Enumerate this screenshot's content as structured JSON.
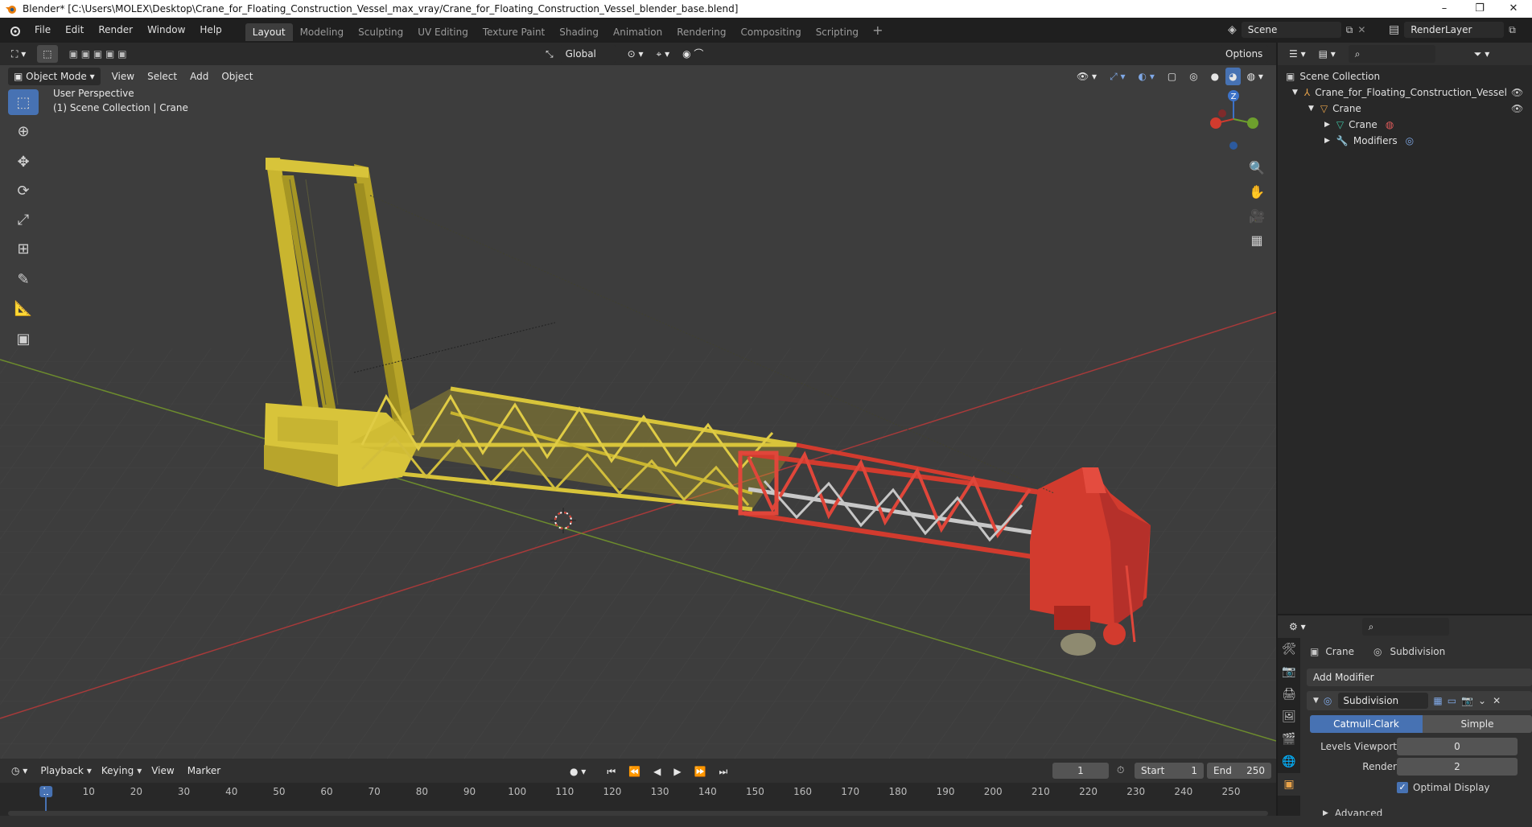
{
  "window": {
    "title": "Blender* [C:\\Users\\MOLEX\\Desktop\\Crane_for_Floating_Construction_Vessel_max_vray/Crane_for_Floating_Construction_Vessel_blender_base.blend]",
    "minimize": "–",
    "restore": "❐",
    "close": "✕"
  },
  "menu": {
    "file": "File",
    "edit": "Edit",
    "render": "Render",
    "window": "Window",
    "help": "Help"
  },
  "workspaces": [
    "Layout",
    "Modeling",
    "Sculpting",
    "UV Editing",
    "Texture Paint",
    "Shading",
    "Animation",
    "Rendering",
    "Compositing",
    "Scripting"
  ],
  "active_workspace": "Layout",
  "scene": {
    "name": "Scene",
    "view_layer": "RenderLayer"
  },
  "viewport": {
    "mode": "Object Mode",
    "menus": [
      "View",
      "Select",
      "Add",
      "Object"
    ],
    "transform_orientation": "Global",
    "options_label": "Options",
    "perspective_label": "User Perspective",
    "collection_label": "(1) Scene Collection | Crane",
    "gizmo_z": "Z",
    "tools": [
      "select-box",
      "cursor",
      "move",
      "rotate",
      "scale",
      "transform",
      "annotate",
      "measure",
      "add-cube"
    ],
    "colors": {
      "background": "#3d3d3d",
      "yellow_part": "#d8c43a",
      "red_part": "#d23b2e",
      "x_axis": "#a83a3a",
      "y_axis": "#6d8c2d"
    }
  },
  "outliner": {
    "root": "Scene Collection",
    "items": [
      {
        "label": "Crane_for_Floating_Construction_Vessel",
        "depth": 1,
        "icon": "armature-icon"
      },
      {
        "label": "Crane",
        "depth": 2,
        "icon": "object-icon"
      },
      {
        "label": "Crane",
        "depth": 3,
        "icon": "mesh-icon"
      },
      {
        "label": "Modifiers",
        "depth": 3,
        "icon": "wrench-icon"
      }
    ]
  },
  "properties": {
    "object_name": "Crane",
    "modifier_breadcrumb": "Subdivision",
    "add_modifier": "Add Modifier",
    "modifier_name": "Subdivision",
    "algorithm_options": [
      "Catmull-Clark",
      "Simple"
    ],
    "active_algorithm": "Catmull-Clark",
    "levels_viewport_label": "Levels Viewport",
    "levels_viewport_value": "0",
    "render_label": "Render",
    "render_value": "2",
    "optimal_display": "Optimal Display",
    "advanced": "Advanced"
  },
  "timeline": {
    "menus": [
      "Playback",
      "Keying",
      "View",
      "Marker"
    ],
    "current_frame": "1",
    "start_label": "Start",
    "start_value": "1",
    "end_label": "End",
    "end_value": "250",
    "ticks": [
      "1",
      "10",
      "20",
      "30",
      "40",
      "50",
      "60",
      "70",
      "80",
      "90",
      "100",
      "110",
      "120",
      "130",
      "140",
      "150",
      "160",
      "170",
      "180",
      "190",
      "200",
      "210",
      "220",
      "230",
      "240",
      "250"
    ]
  }
}
